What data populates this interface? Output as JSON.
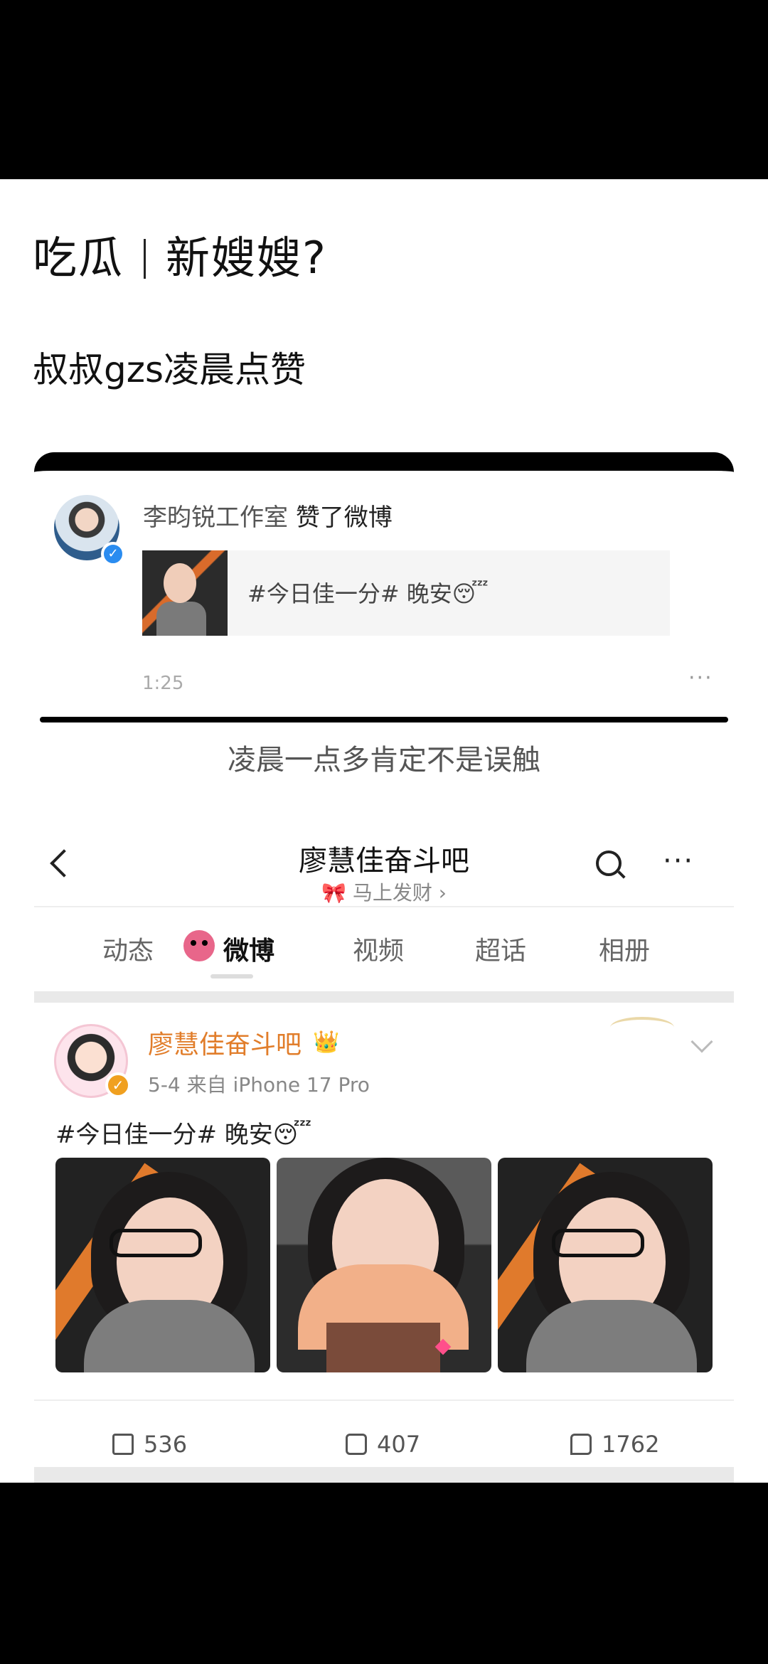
{
  "headline": {
    "left": "吃瓜",
    "right": "新嫂嫂?"
  },
  "subheadline": "叔叔gzs凌晨点赞",
  "notification": {
    "actor": "李昀锐工作室",
    "action": "赞了微博",
    "post_text": "#今日佳一分# 晚安😴",
    "time": "1:25",
    "more": "···"
  },
  "caption": "凌晨一点多肯定不是误触",
  "weibo_page": {
    "title": "廖慧佳奋斗吧",
    "subtitle": "🎀 马上发财 ›",
    "more": "···",
    "tabs": [
      "动态",
      "微博",
      "视频",
      "超话",
      "相册"
    ],
    "active_tab": "微博"
  },
  "post": {
    "author": "廖慧佳奋斗吧",
    "crown": "👑",
    "date_source": "5-4  来自 iPhone 17 Pro",
    "text": "#今日佳一分# 晚安😴",
    "reposts": "536",
    "comments": "407",
    "likes": "1762"
  },
  "colors": {
    "accent_orange": "#e17d2a",
    "verify_blue": "#2a8cf0",
    "verify_gold": "#f0a020"
  }
}
